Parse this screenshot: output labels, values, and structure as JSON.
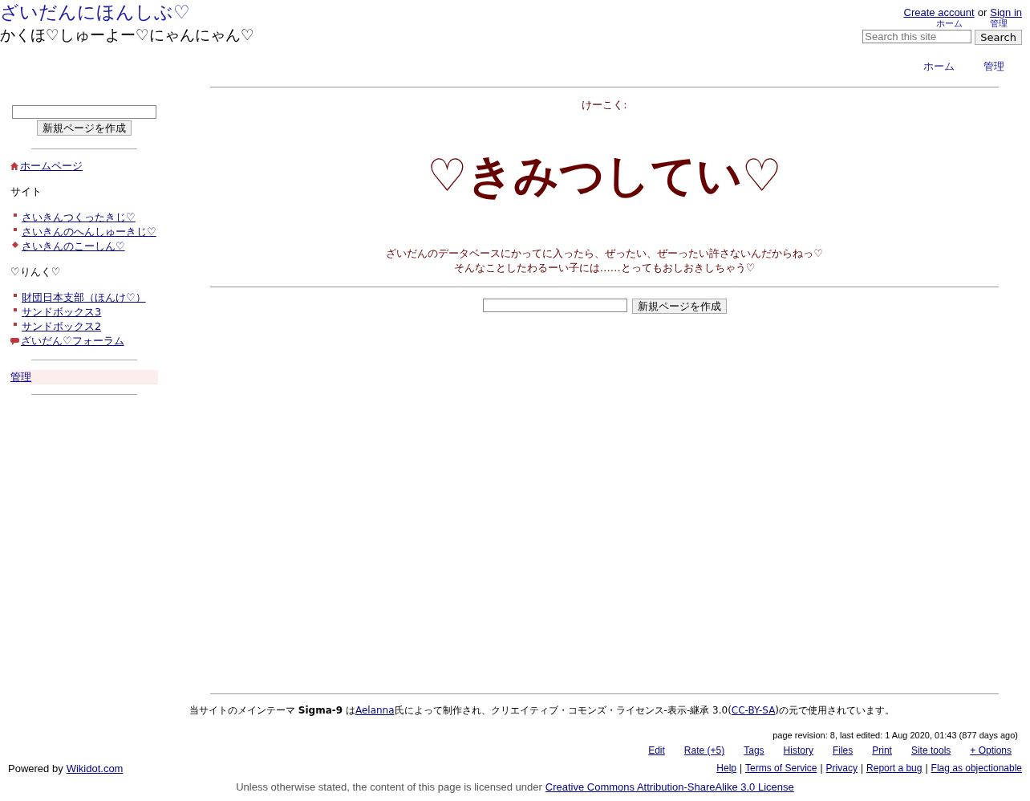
{
  "header": {
    "site_title": "ざいだんにほんしぶ♡",
    "subtitle": "かくほ♡しゅーよー♡にゃんにゃん♡"
  },
  "account": {
    "create": "Create account",
    "or": "or",
    "sign_in": "Sign in"
  },
  "top_nav": [
    "ホーム",
    "管理"
  ],
  "search": {
    "placeholder": "Search this site",
    "button": "Search"
  },
  "nav": [
    "ホーム",
    "管理"
  ],
  "sidebar": {
    "new_page_button": "新規ページを作成",
    "home": {
      "kind": "home",
      "label": "ホームページ"
    },
    "sections": [
      {
        "heading": "サイト",
        "items": [
          {
            "kind": "bullet",
            "label": "さいきんつくったきじ♡"
          },
          {
            "kind": "bullet",
            "label": "さいきんのへんしゅーきじ♡"
          },
          {
            "kind": "diamond",
            "label": "さいきんのこーしん♡"
          }
        ]
      },
      {
        "heading": "♡りんく♡",
        "items": [
          {
            "kind": "bullet",
            "label": "財団日本支部（ほんけ♡）"
          },
          {
            "kind": "bullet",
            "label": "サンドボックス3"
          },
          {
            "kind": "bullet",
            "label": "サンドボックス2"
          },
          {
            "kind": "speech",
            "label": "ざいだん♡フォーラム"
          }
        ]
      }
    ],
    "admin_link": "管理"
  },
  "content": {
    "warning_label": "けーこく:",
    "headline": "♡きみつしてい♡",
    "message_lines": [
      "ざいだんのデータベースにかってに入ったら、ぜったい、ぜーったい許さないんだからねっ♡",
      "そんなことしたわるーい子には……とってもおしおきしちゃう♡"
    ],
    "new_page_button": "新規ページを作成"
  },
  "credit": [
    {
      "kind": "text",
      "text": "当サイトのメインテーマ **Sigma-9** は"
    },
    {
      "kind": "link",
      "text": "Aelanna"
    },
    {
      "kind": "text",
      "text": "氏によって制作され、クリエイティブ・コモンズ・ライセンス-表示-継承 3.0("
    },
    {
      "kind": "link",
      "text": "CC-BY-SA"
    },
    {
      "kind": "text",
      "text": ")の元で使用されています。"
    }
  ],
  "page_info": "page revision: 8, last edited: 1 Aug 2020, 01:43 (877 days ago)",
  "page_options": [
    "Edit",
    "Rate (+5)",
    "Tags",
    "History",
    "Files",
    "Print",
    "Site tools",
    "+ Options"
  ],
  "powered_by": {
    "text": "Powered by",
    "link": "Wikidot.com"
  },
  "footer_links": [
    {
      "label": "Help"
    },
    {
      "separator": "|",
      "label": "Terms of Service"
    },
    {
      "separator": "|",
      "label": "Privacy"
    },
    {
      "separator": "|",
      "label": "Report a bug"
    },
    {
      "separator": "|",
      "label": "Flag as objectionable"
    }
  ],
  "license": {
    "text": "Unless otherwise stated, the content of this page is licensed under",
    "link": "Creative Commons Attribution-ShareAlike 3.0 License"
  }
}
